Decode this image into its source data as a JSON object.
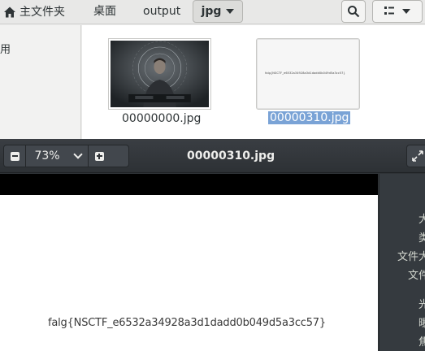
{
  "file_manager": {
    "breadcrumbs": [
      "主文件夹",
      "桌面",
      "output",
      "jpg"
    ],
    "sidebar_partial_label": "用",
    "files": [
      {
        "name": "00000000.jpg",
        "selected": false
      },
      {
        "name": "00000310.jpg",
        "selected": true,
        "thumbnail_text": "falg{NSCTF_e6532a34928a3d1dadd0b049d5a3cc57}"
      }
    ],
    "icons": {
      "home": "home-icon",
      "search": "search-icon",
      "view": "view-options-icon",
      "dropdown": "chevron-down-icon"
    }
  },
  "viewer": {
    "zoom": "73%",
    "title": "00000310.jpg",
    "image_text": "falg{NSCTF_e6532a34928a3d1dadd0b049d5a3cc57}",
    "properties_partial": [
      "大小",
      "类型",
      "文件大小",
      "文件夹",
      "光圈",
      "曝光",
      "焦距"
    ],
    "icons": {
      "zoom_out": "zoom-out-icon",
      "zoom_in": "zoom-in-icon",
      "zoom_menu": "chevron-down-icon",
      "fullscreen": "fullscreen-icon"
    }
  },
  "colors": {
    "selection": "#7aa3d6",
    "viewer_bg": "#2f3337",
    "header_bg": "#e8e8e7"
  }
}
